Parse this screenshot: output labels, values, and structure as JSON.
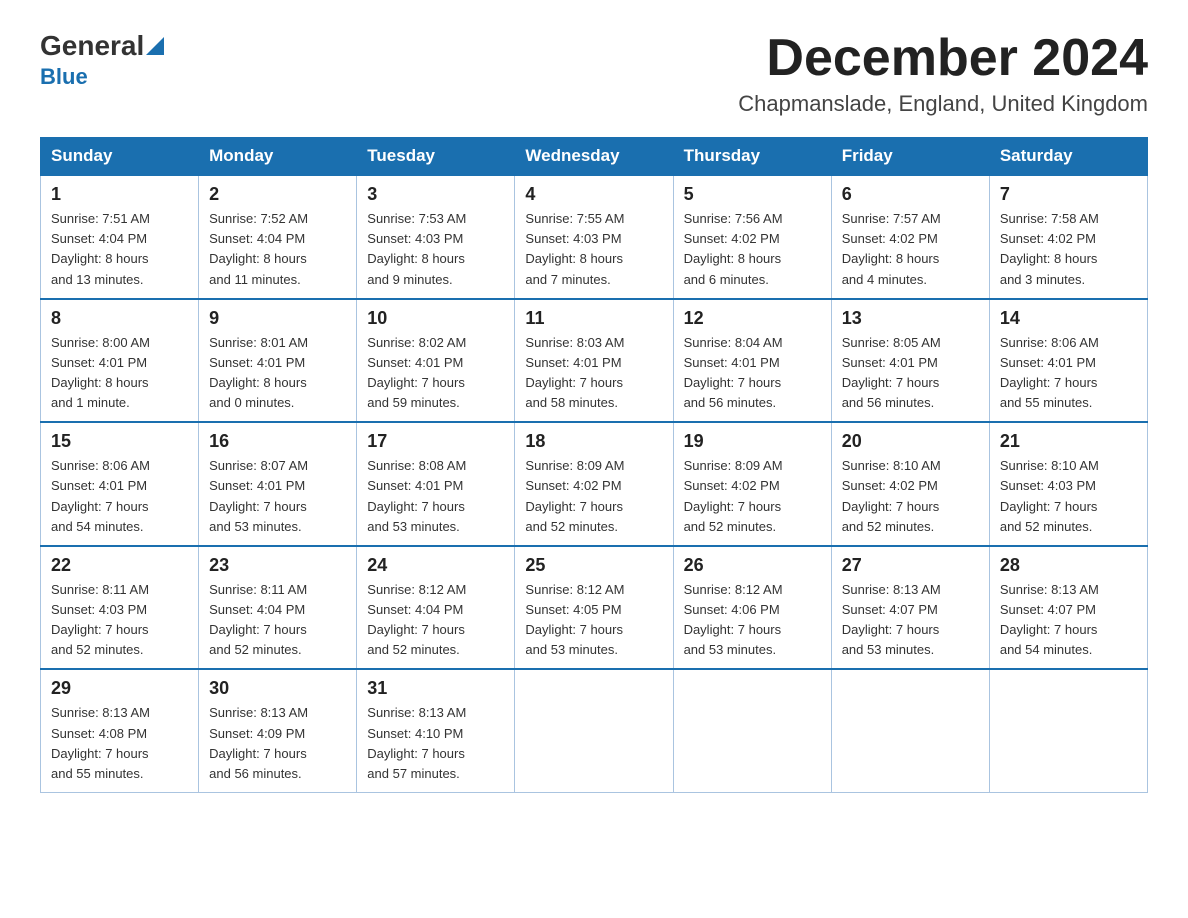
{
  "header": {
    "logo_general": "General",
    "logo_blue": "Blue",
    "month_title": "December 2024",
    "location": "Chapmanslade, England, United Kingdom"
  },
  "days_of_week": [
    "Sunday",
    "Monday",
    "Tuesday",
    "Wednesday",
    "Thursday",
    "Friday",
    "Saturday"
  ],
  "weeks": [
    [
      {
        "day": "1",
        "info": "Sunrise: 7:51 AM\nSunset: 4:04 PM\nDaylight: 8 hours\nand 13 minutes."
      },
      {
        "day": "2",
        "info": "Sunrise: 7:52 AM\nSunset: 4:04 PM\nDaylight: 8 hours\nand 11 minutes."
      },
      {
        "day": "3",
        "info": "Sunrise: 7:53 AM\nSunset: 4:03 PM\nDaylight: 8 hours\nand 9 minutes."
      },
      {
        "day": "4",
        "info": "Sunrise: 7:55 AM\nSunset: 4:03 PM\nDaylight: 8 hours\nand 7 minutes."
      },
      {
        "day": "5",
        "info": "Sunrise: 7:56 AM\nSunset: 4:02 PM\nDaylight: 8 hours\nand 6 minutes."
      },
      {
        "day": "6",
        "info": "Sunrise: 7:57 AM\nSunset: 4:02 PM\nDaylight: 8 hours\nand 4 minutes."
      },
      {
        "day": "7",
        "info": "Sunrise: 7:58 AM\nSunset: 4:02 PM\nDaylight: 8 hours\nand 3 minutes."
      }
    ],
    [
      {
        "day": "8",
        "info": "Sunrise: 8:00 AM\nSunset: 4:01 PM\nDaylight: 8 hours\nand 1 minute."
      },
      {
        "day": "9",
        "info": "Sunrise: 8:01 AM\nSunset: 4:01 PM\nDaylight: 8 hours\nand 0 minutes."
      },
      {
        "day": "10",
        "info": "Sunrise: 8:02 AM\nSunset: 4:01 PM\nDaylight: 7 hours\nand 59 minutes."
      },
      {
        "day": "11",
        "info": "Sunrise: 8:03 AM\nSunset: 4:01 PM\nDaylight: 7 hours\nand 58 minutes."
      },
      {
        "day": "12",
        "info": "Sunrise: 8:04 AM\nSunset: 4:01 PM\nDaylight: 7 hours\nand 56 minutes."
      },
      {
        "day": "13",
        "info": "Sunrise: 8:05 AM\nSunset: 4:01 PM\nDaylight: 7 hours\nand 56 minutes."
      },
      {
        "day": "14",
        "info": "Sunrise: 8:06 AM\nSunset: 4:01 PM\nDaylight: 7 hours\nand 55 minutes."
      }
    ],
    [
      {
        "day": "15",
        "info": "Sunrise: 8:06 AM\nSunset: 4:01 PM\nDaylight: 7 hours\nand 54 minutes."
      },
      {
        "day": "16",
        "info": "Sunrise: 8:07 AM\nSunset: 4:01 PM\nDaylight: 7 hours\nand 53 minutes."
      },
      {
        "day": "17",
        "info": "Sunrise: 8:08 AM\nSunset: 4:01 PM\nDaylight: 7 hours\nand 53 minutes."
      },
      {
        "day": "18",
        "info": "Sunrise: 8:09 AM\nSunset: 4:02 PM\nDaylight: 7 hours\nand 52 minutes."
      },
      {
        "day": "19",
        "info": "Sunrise: 8:09 AM\nSunset: 4:02 PM\nDaylight: 7 hours\nand 52 minutes."
      },
      {
        "day": "20",
        "info": "Sunrise: 8:10 AM\nSunset: 4:02 PM\nDaylight: 7 hours\nand 52 minutes."
      },
      {
        "day": "21",
        "info": "Sunrise: 8:10 AM\nSunset: 4:03 PM\nDaylight: 7 hours\nand 52 minutes."
      }
    ],
    [
      {
        "day": "22",
        "info": "Sunrise: 8:11 AM\nSunset: 4:03 PM\nDaylight: 7 hours\nand 52 minutes."
      },
      {
        "day": "23",
        "info": "Sunrise: 8:11 AM\nSunset: 4:04 PM\nDaylight: 7 hours\nand 52 minutes."
      },
      {
        "day": "24",
        "info": "Sunrise: 8:12 AM\nSunset: 4:04 PM\nDaylight: 7 hours\nand 52 minutes."
      },
      {
        "day": "25",
        "info": "Sunrise: 8:12 AM\nSunset: 4:05 PM\nDaylight: 7 hours\nand 53 minutes."
      },
      {
        "day": "26",
        "info": "Sunrise: 8:12 AM\nSunset: 4:06 PM\nDaylight: 7 hours\nand 53 minutes."
      },
      {
        "day": "27",
        "info": "Sunrise: 8:13 AM\nSunset: 4:07 PM\nDaylight: 7 hours\nand 53 minutes."
      },
      {
        "day": "28",
        "info": "Sunrise: 8:13 AM\nSunset: 4:07 PM\nDaylight: 7 hours\nand 54 minutes."
      }
    ],
    [
      {
        "day": "29",
        "info": "Sunrise: 8:13 AM\nSunset: 4:08 PM\nDaylight: 7 hours\nand 55 minutes."
      },
      {
        "day": "30",
        "info": "Sunrise: 8:13 AM\nSunset: 4:09 PM\nDaylight: 7 hours\nand 56 minutes."
      },
      {
        "day": "31",
        "info": "Sunrise: 8:13 AM\nSunset: 4:10 PM\nDaylight: 7 hours\nand 57 minutes."
      },
      null,
      null,
      null,
      null
    ]
  ]
}
